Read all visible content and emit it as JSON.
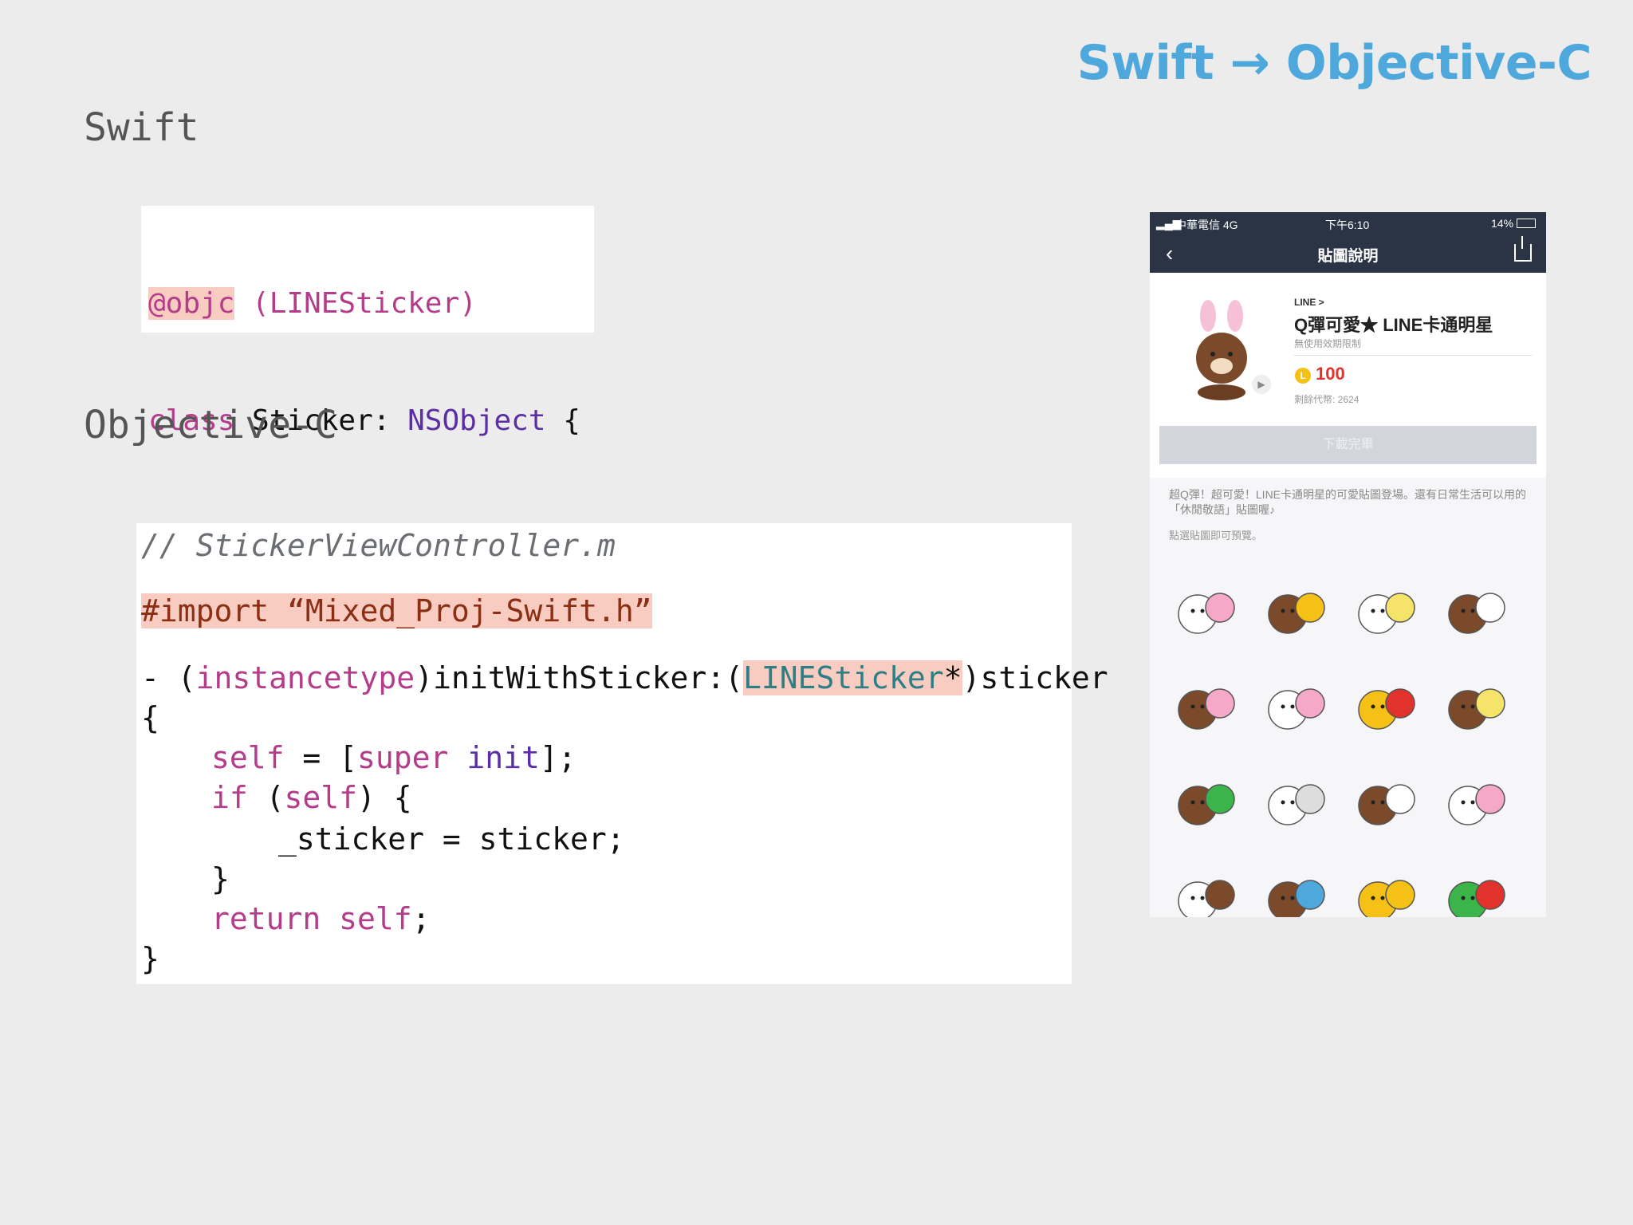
{
  "slide": {
    "title": "Swift → Objective-C",
    "swift_label": "Swift",
    "objc_label": "Objective-C"
  },
  "swift_code": {
    "line1_objc": "@objc",
    "line1_name": "(LINESticker)",
    "line2_class": "class",
    "line2_rest": " Sticker: ",
    "line2_type": "NSObject",
    "line2_brace": " {",
    "line3": "}"
  },
  "objc_code": {
    "comment": "// StickerViewController.m",
    "import": "#import “Mixed_Proj-Swift.h”",
    "sig_dash": "- (",
    "sig_kw": "instancetype",
    "sig_mid": ")initWithSticker:(",
    "sig_type": "LINESticker",
    "sig_star": "*",
    "sig_end": ")sticker",
    "open_brace": "{",
    "self_kw": "self",
    "assign": " = [",
    "super_kw": "super",
    "init_word": "init",
    "assign_end": "];",
    "if_kw": "if",
    "if_mid": " (",
    "if_self": "self",
    "if_end": ") {",
    "sticker_line": "_sticker = sticker;",
    "close_inner": "}",
    "return_kw": "return",
    "return_self": "self",
    "semicolon": ";",
    "close_brace": "}"
  },
  "phone": {
    "carrier": "中華電信  4G",
    "time": "下午6:10",
    "battery": "14%",
    "nav_title": "貼圖說明",
    "back_icon": "chevron-left-icon",
    "share_icon": "share-icon",
    "vendor": "LINE >",
    "product_name": "Q彈可愛★ LINE卡通明星",
    "expiry": "無使用效期限制",
    "coin_letter": "L",
    "price": "100",
    "remaining": "剩餘代幣: 2624",
    "download_button": "下載完畢",
    "description": "超Q彈！超可愛！LINE卡通明星的可愛貼圖登場。還有日常生活可以用的「休閒敬語」貼圖喔♪",
    "preview_hint": "點選貼圖即可預覽。",
    "sticker_count": 16
  },
  "colors": {
    "title_blue": "#4fa8dc",
    "keyword_pink": "#b43c8a",
    "type_purple": "#5a2fa3",
    "highlight": "#f8ccc0",
    "navbar": "#2a3444",
    "price_red": "#e2322c"
  }
}
